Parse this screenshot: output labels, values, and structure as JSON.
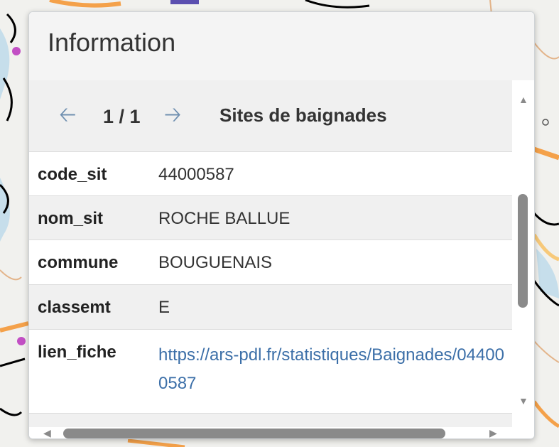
{
  "popup": {
    "title": "Information",
    "nav": {
      "prev_icon": "arrow-left-icon",
      "next_icon": "arrow-right-icon",
      "counter": "1 / 1",
      "layer_name": "Sites de baignades"
    },
    "attributes": [
      {
        "key": "code_sit",
        "value": "44000587"
      },
      {
        "key": "nom_sit",
        "value": "ROCHE BALLUE"
      },
      {
        "key": "commune",
        "value": "BOUGUENAIS"
      },
      {
        "key": "classemt",
        "value": "E"
      },
      {
        "key": "lien_fiche",
        "value": "https://ars-pdl.fr/statistiques/Baignades/044000587"
      }
    ]
  },
  "colors": {
    "accent_arrow": "#6f8fb0",
    "link": "#3c6fa8",
    "map_road": "#f4a14a",
    "map_poi": "#c24fc4"
  }
}
